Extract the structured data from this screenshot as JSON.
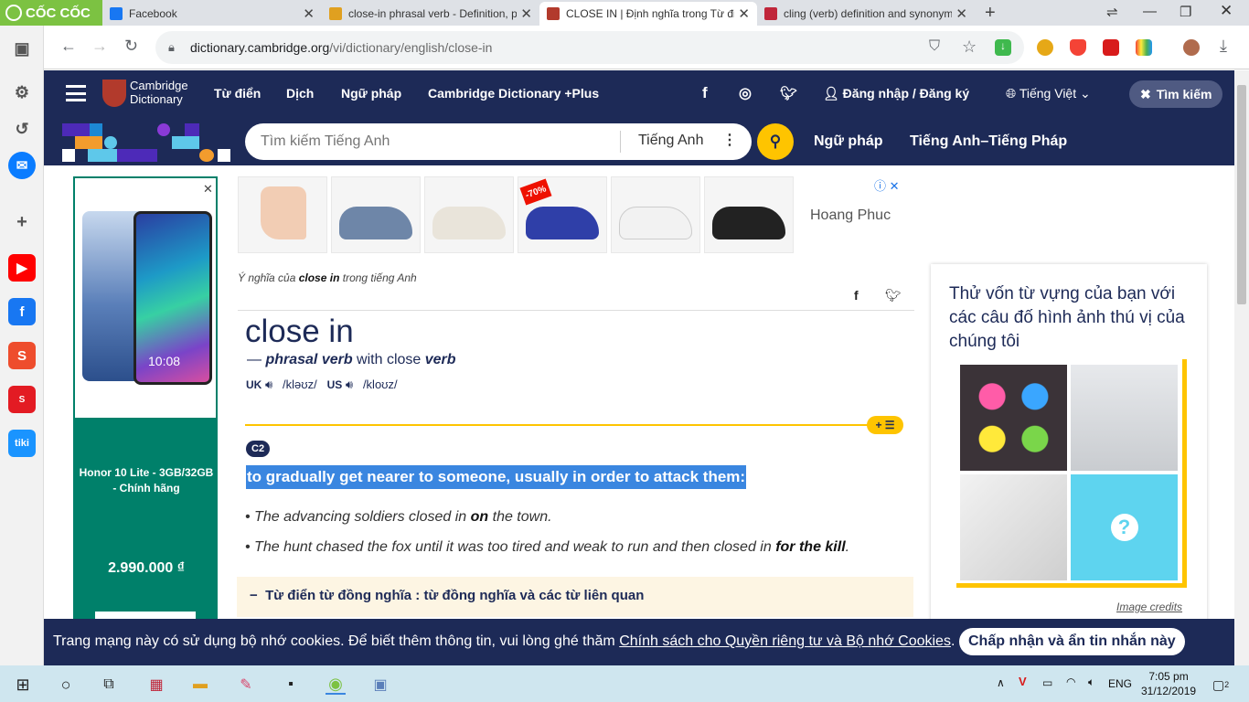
{
  "browser": {
    "brand": "CỐC CỐC",
    "tabs": [
      {
        "title": "Facebook",
        "favicon_color": "#1877f2"
      },
      {
        "title": "close-in phrasal verb - Definition, p",
        "favicon_color": "#e0a020"
      },
      {
        "title": "CLOSE IN | Định nghĩa trong Từ đi",
        "favicon_color": "#b23a2c",
        "active": true
      },
      {
        "title": "cling (verb) definition and synonym",
        "favicon_color": "#c0263a"
      }
    ],
    "url_host": "dictionary.cambridge.org",
    "url_path": "/vi/dictionary/english/close-in"
  },
  "site": {
    "logo_line1": "Cambridge",
    "logo_line2": "Dictionary",
    "nav": [
      "Từ điển",
      "Dịch",
      "Ngữ pháp",
      "Cambridge Dictionary +Plus"
    ],
    "login": "Đăng nhập / Đăng ký",
    "language": "Tiếng Việt",
    "search_toggle": "Tìm kiếm",
    "search_placeholder": "Tìm kiếm Tiếng Anh",
    "search_lang": "Tiếng Anh",
    "band_links": [
      "Ngữ pháp",
      "Tiếng Anh–Tiếng Pháp"
    ]
  },
  "left_ad": {
    "clock": "10:08",
    "product": "Honor 10 Lite - 3GB/32GB - Chính hãng",
    "price": "2.990.000 ₫"
  },
  "shoe_ad": {
    "discount": "-70%",
    "advertiser": "Hoang Phuc",
    "colors": [
      "#f2cdb4",
      "#6e86a8",
      "#e9e4da",
      "#2f3fa8",
      "#f2f2f2",
      "#222222"
    ]
  },
  "entry": {
    "breadcrumb_pre": "Ý nghĩa của ",
    "breadcrumb_word": "close in",
    "breadcrumb_post": " trong tiếng Anh",
    "headword": "close in",
    "pos_dash": "— ",
    "pos": "phrasal verb",
    "pos_with": " with close ",
    "pos_verb": "verb",
    "uk_label": "UK",
    "uk_ipa": "/kləʊz/",
    "us_label": "US",
    "us_ipa": "/kloʊz/",
    "level": "C2",
    "definition": "to gradually get nearer to someone, usually in order to attack them:",
    "examples": [
      {
        "pre": "The advancing soldiers closed in ",
        "bold": "on",
        "post": " the town."
      },
      {
        "pre": "The hunt chased the fox until it was too tired and weak to run and then closed in ",
        "bold": "for the kill",
        "post": "."
      }
    ],
    "thesaurus": "Từ điển từ đồng nghĩa : từ đồng nghĩa và các từ liên quan"
  },
  "quiz": {
    "text": "Thử vốn từ vựng của bạn với các câu đố hình ảnh thú vị của chúng tôi",
    "credits": "Image credits"
  },
  "cookie": {
    "text": "Trang mạng này có sử dụng bộ nhớ cookies. Để biết thêm thông tin, vui lòng ghé thăm ",
    "link": "Chính sách cho Quyền riêng tư và Bộ nhớ Cookies",
    "text_end": ".",
    "accept": "Chấp nhận và ẩn tin nhắn này"
  },
  "taskbar": {
    "lang": "ENG",
    "time": "7:05 pm",
    "date": "31/12/2019",
    "notifications": "2"
  }
}
